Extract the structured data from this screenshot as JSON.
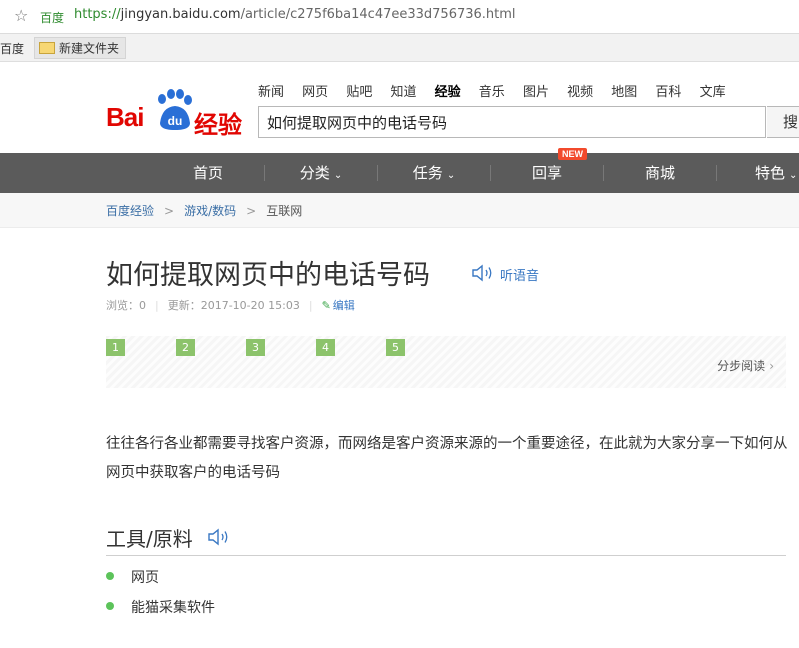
{
  "browser": {
    "site_tag": "百度",
    "url_scheme": "https://",
    "url_host": "jingyan.baidu.com",
    "url_path": "/article/c275f6ba14c47ee33d756736.html",
    "bookmarks": [
      {
        "label": "百度"
      },
      {
        "label": "新建文件夹"
      }
    ]
  },
  "header": {
    "logo_text_bai": "Bai",
    "logo_text_du": "du",
    "logo_text_jingyan": "经验",
    "topnav": [
      "新闻",
      "网页",
      "贴吧",
      "知道",
      "经验",
      "音乐",
      "图片",
      "视频",
      "地图",
      "百科",
      "文库"
    ],
    "topnav_active": "经验",
    "search_value": "如何提取网页中的电话号码",
    "search_button": "搜"
  },
  "mainnav": {
    "items": [
      "首页",
      "分类",
      "任务",
      "回享",
      "商城",
      "特色"
    ],
    "dropdown_items": [
      "分类",
      "任务",
      "特色"
    ],
    "new_badge": "NEW"
  },
  "breadcrumb": {
    "items": [
      "百度经验",
      "游戏/数码",
      "互联网"
    ]
  },
  "article": {
    "title": "如何提取网页中的电话号码",
    "listen_label": "听语音",
    "views_label": "浏览：",
    "views_value": "0",
    "updated_label": "更新：",
    "updated_value": "2017-10-20 15:03",
    "edit_label": "编辑",
    "steps": [
      "1",
      "2",
      "3",
      "4",
      "5"
    ],
    "step_read_label": "分步阅读",
    "intro": "往往各行各业都需要寻找客户资源，而网络是客户资源来源的一个重要途径，在此就为大家分享一下如何从网页中获取客户的电话号码",
    "tools_title": "工具/原料",
    "tools": [
      "网页",
      "能猫采集软件"
    ]
  },
  "colors": {
    "brand_red": "#e10602",
    "brand_blue": "#2a6fd6",
    "nav_bg": "#5b5b5b",
    "step_green": "#8cc36b",
    "bullet_green": "#5cc35a",
    "link_blue": "#3a78c3",
    "new_badge": "#f24a2c"
  },
  "icons": {
    "bookmark_star": "star-icon",
    "folder": "folder-icon",
    "speaker": "speaker-icon",
    "pencil": "pencil-icon",
    "dropdown": "chevron-down-icon",
    "step_chevron": "chevron-right-icon"
  }
}
